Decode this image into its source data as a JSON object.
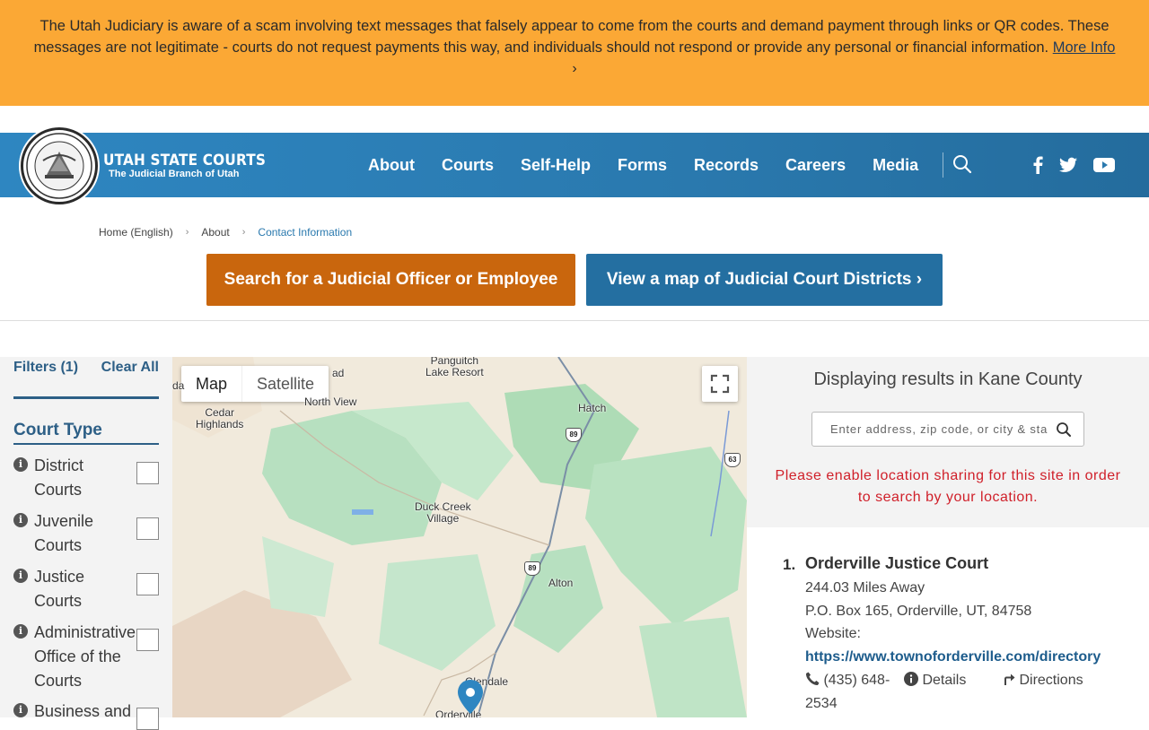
{
  "alert": {
    "message": "The Utah Judiciary is aware of a scam involving text messages that falsely appear to come from the courts and demand payment through links or QR codes. These messages are not legitimate - courts do not request payments this way, and individuals should not respond or provide any personal or financial information.",
    "link_label": "More Info",
    "chevron": "›"
  },
  "header": {
    "brand_title": "UTAH STATE COURTS",
    "brand_subtitle": "The Judicial Branch of Utah",
    "nav": [
      "About",
      "Courts",
      "Self-Help",
      "Forms",
      "Records",
      "Careers",
      "Media"
    ]
  },
  "breadcrumb": [
    "Home (English)",
    "About",
    "Contact Information"
  ],
  "buttons": {
    "search_officer": "Search for a Judicial Officer or Employee",
    "view_map": "View a map of Judicial Court Districts ›"
  },
  "filters": {
    "header": "Filters (1)",
    "clear": "Clear All",
    "section_title": "Court Type",
    "items": [
      {
        "label": "District Courts"
      },
      {
        "label": "Juvenile Courts"
      },
      {
        "label": "Justice Courts"
      },
      {
        "label": "Administrative Office of the Courts"
      },
      {
        "label": "Business and"
      }
    ]
  },
  "map": {
    "toggle_map": "Map",
    "toggle_satellite": "Satellite",
    "labels": {
      "panguitch_lake": "Panguitch\nLake Resort",
      "north_view": "North View",
      "road": "ad",
      "cedar_highlands": "Cedar\nHighlands",
      "hatch": "Hatch",
      "duck_creek": "Duck Creek\nVillage",
      "alton": "Alton",
      "glendale": "Glendale",
      "orderville": "Orderville",
      "edge": "da"
    },
    "shields": [
      "89",
      "89",
      "63"
    ]
  },
  "results": {
    "title": "Displaying results in Kane County",
    "search_placeholder": "Enter address, zip code, or city & state",
    "warning": "Please enable location sharing for this site in order to search by your location.",
    "entries": [
      {
        "number": "1.",
        "name": "Orderville Justice Court",
        "distance": "244.03 Miles Away",
        "address": "P.O. Box 165, Orderville, UT, 84758",
        "website_label": "Website:",
        "url": "https://www.townoforderville.com/directory",
        "phone": "(435) 648-2534",
        "details": "Details",
        "directions": "Directions"
      }
    ]
  },
  "colors": {
    "alert_bg": "#fba835",
    "header_blue": "#2a79ae",
    "orange_button": "#c9660d",
    "blue_button": "#246fa1",
    "warning_red": "#d0202a"
  }
}
